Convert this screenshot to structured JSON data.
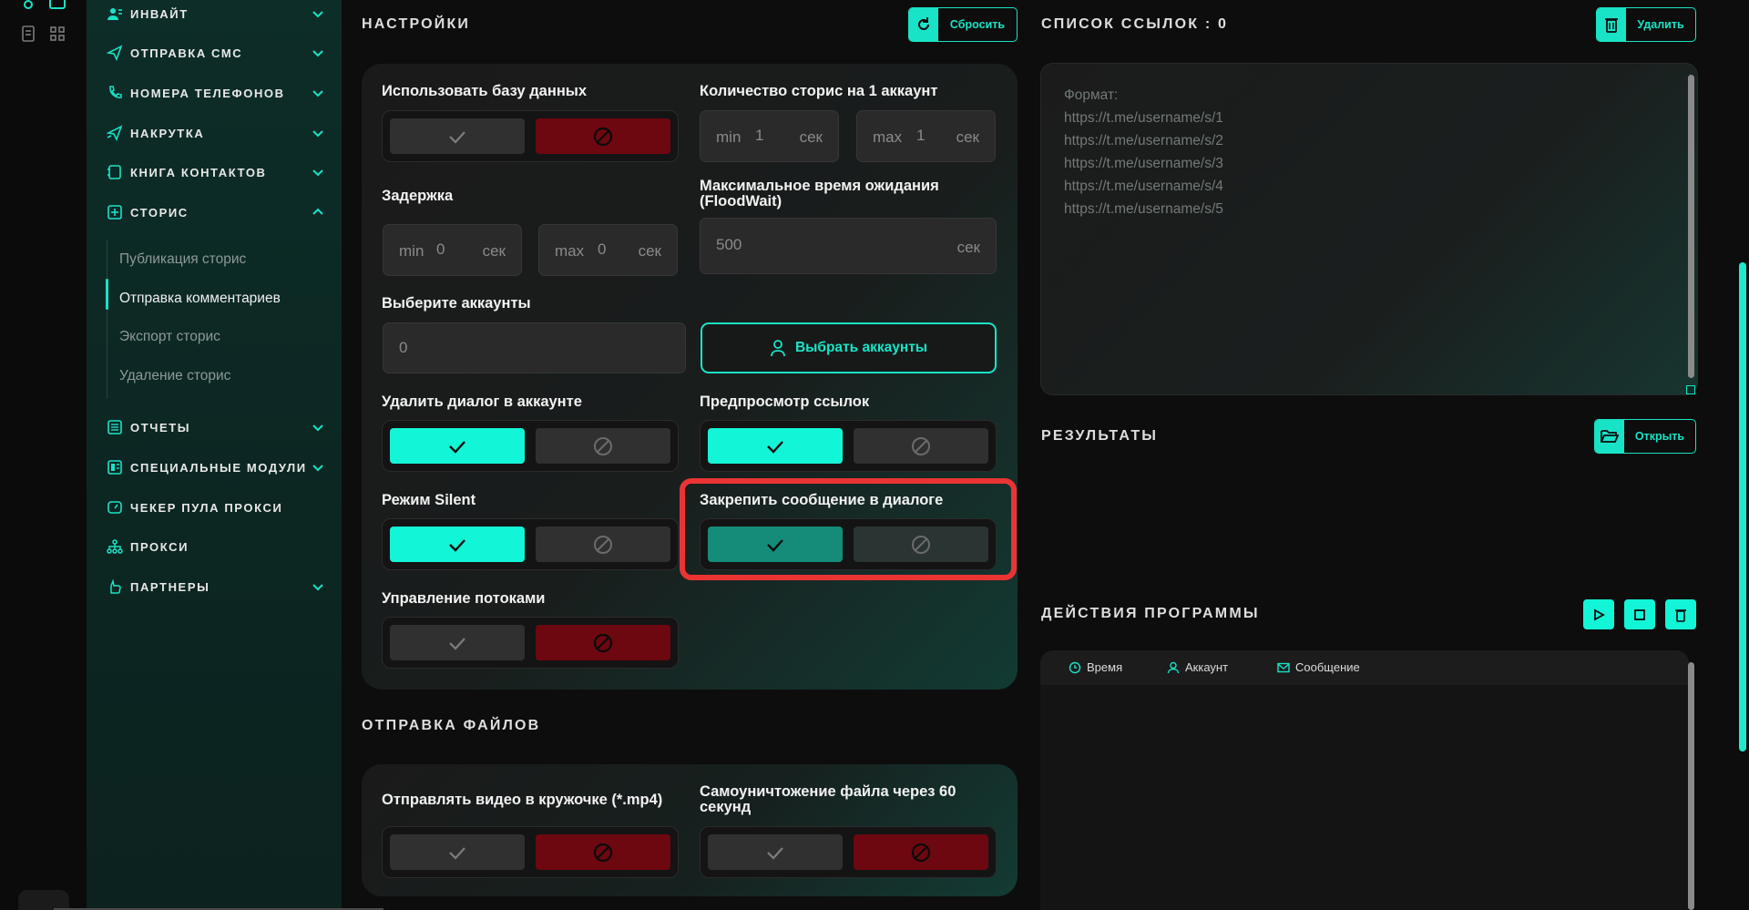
{
  "sidebar": {
    "items": [
      {
        "name": "invite",
        "label": "ИНВАЙТ",
        "icon": "user-group-icon",
        "top": 0
      },
      {
        "name": "sms",
        "label": "ОТПРАВКА СМС",
        "icon": "send-icon"
      },
      {
        "name": "phones",
        "label": "НОМЕРА ТЕЛЕФОНОВ",
        "icon": "phone-icon"
      },
      {
        "name": "boost",
        "label": "НАКРУТКА",
        "icon": "send-boost-icon"
      },
      {
        "name": "contacts",
        "label": "КНИГА КОНТАКТОВ",
        "icon": "contact-book-icon"
      },
      {
        "name": "stories",
        "label": "СТОРИС",
        "icon": "plus-square-icon"
      },
      {
        "name": "reports",
        "label": "ОТЧЕТЫ",
        "icon": "report-icon"
      },
      {
        "name": "modules",
        "label": "СПЕЦИАЛЬНЫЕ МОДУЛИ",
        "icon": "modules-icon"
      },
      {
        "name": "proxy-checker",
        "label": "ЧЕКЕР ПУЛА ПРОКСИ",
        "icon": "gauge-icon"
      },
      {
        "name": "proxy",
        "label": "ПРОКСИ",
        "icon": "network-icon"
      },
      {
        "name": "partners",
        "label": "ПАРТНЕРЫ",
        "icon": "hand-icon"
      }
    ],
    "stories_sub": [
      {
        "label": "Публикация сторис"
      },
      {
        "label": "Отправка комментариев",
        "active": true
      },
      {
        "label": "Экспорт сторис"
      },
      {
        "label": "Удаление сторис"
      }
    ]
  },
  "settings": {
    "title": "НАСТРОЙКИ",
    "reset_label": "Сбросить",
    "use_db_label": "Использовать базу данных",
    "stories_per_account_label": "Количество сторис на 1 аккаунт",
    "stories_min_prefix": "min",
    "stories_min_value": "1",
    "stories_max_prefix": "max",
    "stories_max_value": "1",
    "unit_sec": "сек",
    "delay_label": "Задержка",
    "delay_min_prefix": "min",
    "delay_min_value": "0",
    "delay_max_prefix": "max",
    "delay_max_value": "0",
    "floodwait_label_line1": "Максимальное время ожидания",
    "floodwait_label_line2": "(FloodWait)",
    "floodwait_value": "500",
    "select_accounts_label": "Выберите аккаунты",
    "accounts_value": "0",
    "pick_accounts_button": "Выбрать аккаунты",
    "delete_dialog_label": "Удалить диалог в аккаунте",
    "link_preview_label": "Предпросмотр ссылок",
    "silent_label": "Режим Silent",
    "pin_message_label": "Закрепить сообщение в диалоге",
    "threads_label": "Управление потоками"
  },
  "files": {
    "title": "ОТПРАВКА ФАЙЛОВ",
    "video_circle_label": "Отправлять видео в кружочке (*.mp4)",
    "self_destruct_line1": "Самоуничтожение файла через 60",
    "self_destruct_line2": "секунд"
  },
  "links": {
    "title": "СПИСОК ССЫЛОК : 0",
    "delete_label": "Удалить",
    "placeholder_lines": [
      "Формат:",
      "https://t.me/username/s/1",
      "https://t.me/username/s/2",
      "https://t.me/username/s/3",
      "https://t.me/username/s/4",
      "https://t.me/username/s/5"
    ]
  },
  "results": {
    "title": "РЕЗУЛЬТАТЫ",
    "open_label": "Открыть"
  },
  "actions": {
    "title": "ДЕЙСТВИЯ ПРОГРАММЫ",
    "columns": [
      "Время",
      "Аккаунт",
      "Сообщение"
    ]
  },
  "colors": {
    "accent": "#13f5d7",
    "danger": "#6d0710",
    "highlight": "#ea3434"
  }
}
